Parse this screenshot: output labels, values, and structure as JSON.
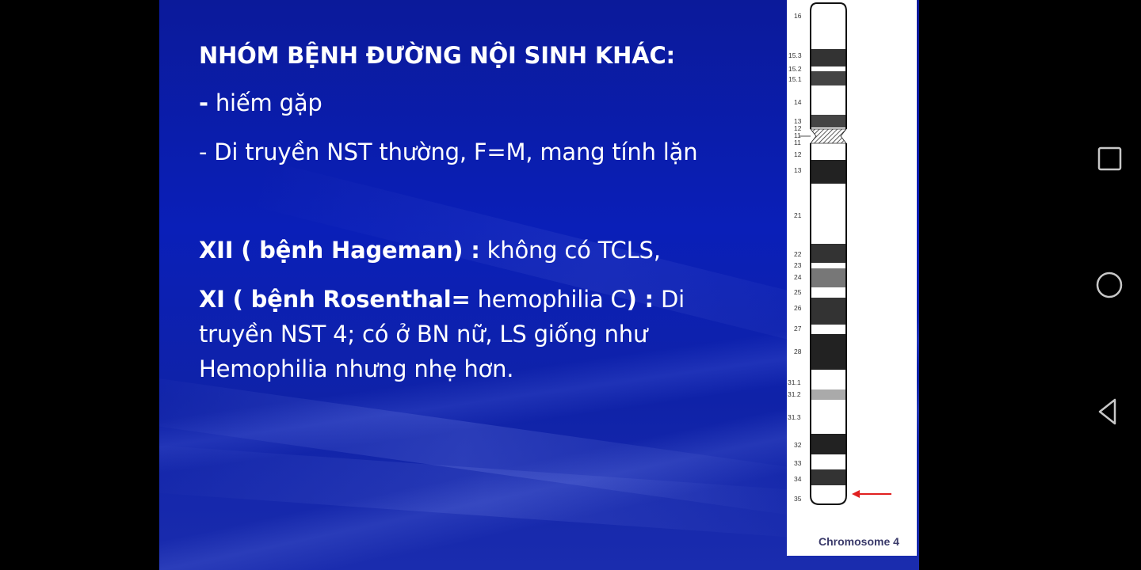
{
  "slide": {
    "heading": "NHÓM BỆNH ĐƯỜNG NỘI SINH KHÁC:",
    "bullet1_dash": "-",
    "bullet1_text": " hiếm gặp",
    "bullet2": "- Di truyền NST thường, F=M, mang tính lặn",
    "para1_bold": "XII ( bệnh Hageman) :",
    "para1_rest": " không có TCLS,",
    "para2_bold1": "XI ( bệnh Rosenthal=",
    "para2_normal1": " hemophilia C",
    "para2_bold2": ") :",
    "para2_normal2": " Di",
    "para2_line2": "truyền NST 4; có ở BN nữ, LS giống như",
    "para2_line3": "Hemophilia nhưng nhẹ hơn."
  },
  "ideogram": {
    "title": "Chromosome 4",
    "band_labels": [
      "16",
      "15.3",
      "15.2",
      "15.1",
      "14",
      "13",
      "12",
      "11",
      "11",
      "12",
      "13",
      "21",
      "22",
      "23",
      "24",
      "25",
      "26",
      "27",
      "28",
      "31.1",
      "31.2",
      "31.3",
      "32",
      "33",
      "34",
      "35"
    ],
    "arrow_color": "#e02020"
  },
  "navbar": {
    "recent_icon": "square-icon",
    "home_icon": "circle-icon",
    "back_icon": "triangle-back-icon"
  }
}
